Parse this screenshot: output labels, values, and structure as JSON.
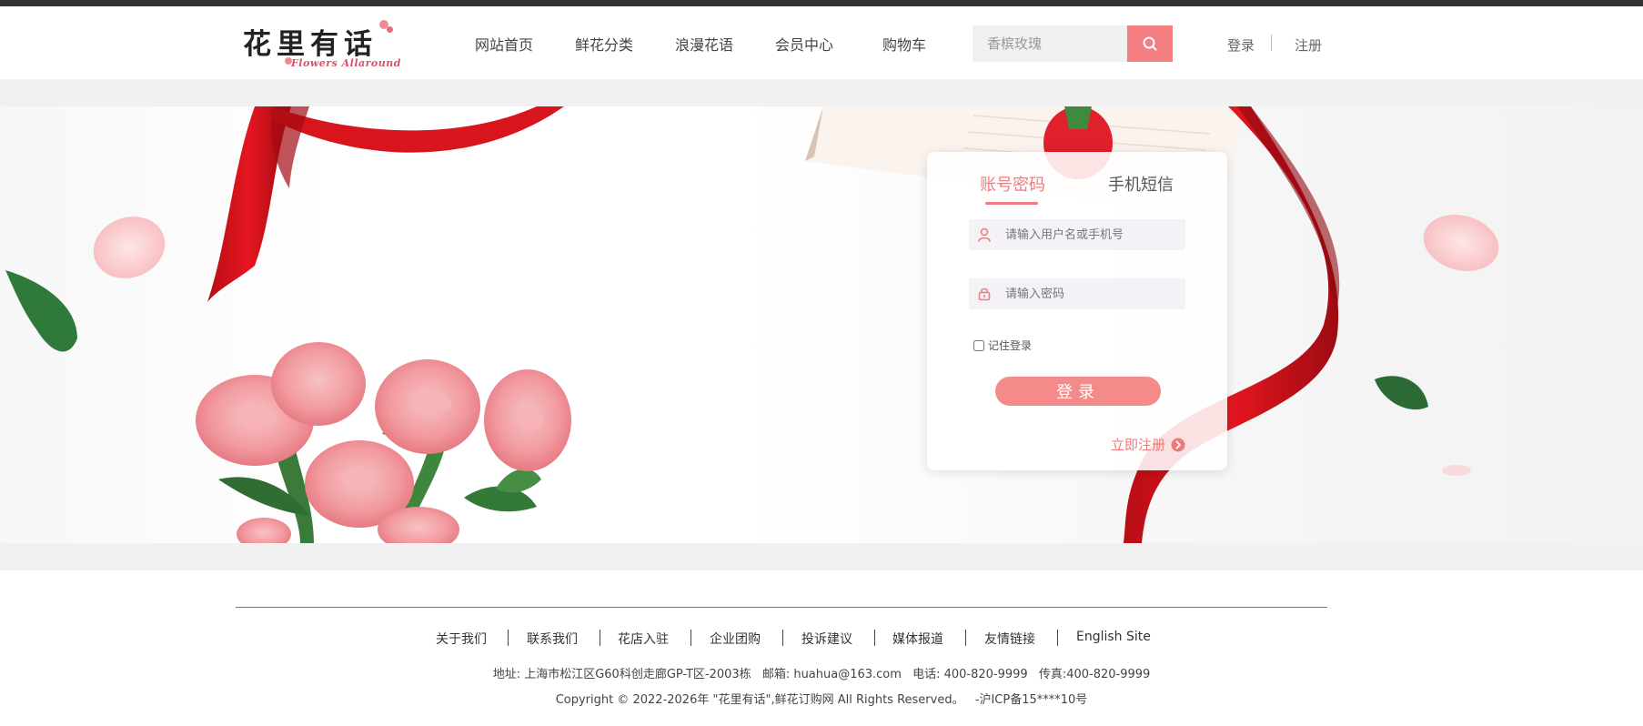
{
  "brand": {
    "logo_text": "花里有话",
    "logo_subtext": "Flowers Allaround"
  },
  "colors": {
    "accent": "#f37f80",
    "topbar": "#333333",
    "text": "#444444"
  },
  "nav": {
    "items": [
      {
        "label": "网站首页"
      },
      {
        "label": "鲜花分类"
      },
      {
        "label": "浪漫花语"
      },
      {
        "label": "会员中心"
      },
      {
        "label": "购物车"
      }
    ]
  },
  "search": {
    "placeholder": "香槟玫瑰",
    "button_icon": "search-icon"
  },
  "auth": {
    "login_label": "登录",
    "register_label": "注册"
  },
  "login_form": {
    "tabs": [
      {
        "label": "账号密码",
        "active": true
      },
      {
        "label": "手机短信",
        "active": false
      }
    ],
    "username_placeholder": "请输入用户名或手机号",
    "username_icon": "user-icon",
    "password_placeholder": "请输入密码",
    "password_icon": "lock-icon",
    "remember_label": "记住登录",
    "submit_label": "登录",
    "register_link_label": "立即注册",
    "register_link_icon": "chevron-right-circle-icon"
  },
  "footer": {
    "links": [
      {
        "label": "关于我们"
      },
      {
        "label": "联系我们"
      },
      {
        "label": "花店入驻"
      },
      {
        "label": "企业团购"
      },
      {
        "label": "投诉建议"
      },
      {
        "label": "媒体报道"
      },
      {
        "label": "友情链接"
      },
      {
        "label": "English Site"
      }
    ],
    "address": "地址: 上海市松江区G60科创走廊GP-T区-2003栋",
    "email": "邮箱: huahua@163.com",
    "phone": "电话: 400-820-9999",
    "fax": "传真:400-820-9999",
    "copyright": "Copyright © 2022-2026年 \"花里有话\",鲜花订购网 All Rights Reserved。",
    "icp": "-沪ICP备15****10号"
  }
}
